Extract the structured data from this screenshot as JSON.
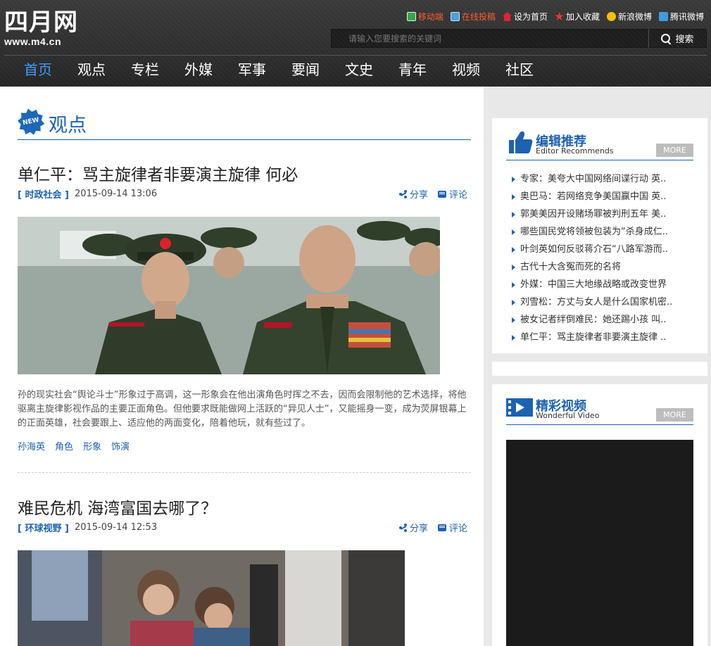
{
  "site": {
    "logo_text": "四月网",
    "logo_url": "www.m4.cn"
  },
  "top_links": [
    {
      "label": "移动端",
      "icon": "mobile-icon",
      "highlight": true
    },
    {
      "label": "在线投稿",
      "icon": "submit-icon",
      "highlight": true
    },
    {
      "label": "设为首页",
      "icon": "home-icon",
      "highlight": false
    },
    {
      "label": "加入收藏",
      "icon": "favorite-icon",
      "highlight": false
    },
    {
      "label": "新浪微博",
      "icon": "sina-weibo-icon",
      "highlight": false
    },
    {
      "label": "腾讯微博",
      "icon": "tencent-weibo-icon",
      "highlight": false
    }
  ],
  "search": {
    "placeholder": "请输入您要搜索的关键词",
    "button_label": "搜索"
  },
  "nav": [
    {
      "label": "首页",
      "active": true
    },
    {
      "label": "观点"
    },
    {
      "label": "专栏"
    },
    {
      "label": "外媒"
    },
    {
      "label": "军事"
    },
    {
      "label": "要闻"
    },
    {
      "label": "文史"
    },
    {
      "label": "青年"
    },
    {
      "label": "视频"
    },
    {
      "label": "社区"
    }
  ],
  "section": {
    "badge": "NEW",
    "title": "观点"
  },
  "articles": [
    {
      "title": "单仁平：骂主旋律者非要演主旋律 何必",
      "category": "[ 时政社会 ]",
      "datetime": "2015-09-14 13:06",
      "share_label": "分享",
      "comment_label": "评论",
      "summary": "孙的现实社会“舆论斗士”形象过于高调，这一形象会在他出演角色时挥之不去，因而会限制他的艺术选择，将他驱离主旋律影视作品的主要正面角色。但他要求既能做网上活跃的“异见人士”，又能摇身一变，成为荧屏银幕上的正面英雄，社会要跟上、适应他的两面变化，陪着他玩，就有些过了。",
      "tags": [
        "孙海英",
        "角色",
        "形象",
        "饰演"
      ]
    },
    {
      "title": "难民危机 海湾富国去哪了？",
      "category": "[ 环球视野 ]",
      "datetime": "2015-09-14 12:53",
      "share_label": "分享",
      "comment_label": "评论"
    }
  ],
  "editor_recommends": {
    "title": "编辑推荐",
    "subtitle": "Editor Recommends",
    "more": "MORE",
    "items": [
      "专家：美夸大中国网络间谍行动 英..",
      "奥巴马：若网络竞争美国赢中国 英..",
      "郭美美因开设赌场罪被判刑五年 美..",
      "哪些国民党将领被包装为“杀身成仁..",
      "叶剑英如何反驳蒋介石“八路军游而..",
      "古代十大含冤而死的名将",
      "外媒：中国三大地缘战略或改变世界",
      "刘雪松：方丈与女人是什么国家机密..",
      "被女记者绊倒难民：她还踢小孩 叫..",
      "单仁平：骂主旋律者非要演主旋律 .."
    ]
  },
  "wonderful_video": {
    "title": "精彩视频",
    "subtitle": "Wonderful Video",
    "more": "MORE"
  },
  "colors": {
    "accent": "#1d62b0",
    "nav_active": "#3a9bff",
    "header_bg": "#2e2e2e",
    "highlight_link": "#ff5a2a"
  }
}
